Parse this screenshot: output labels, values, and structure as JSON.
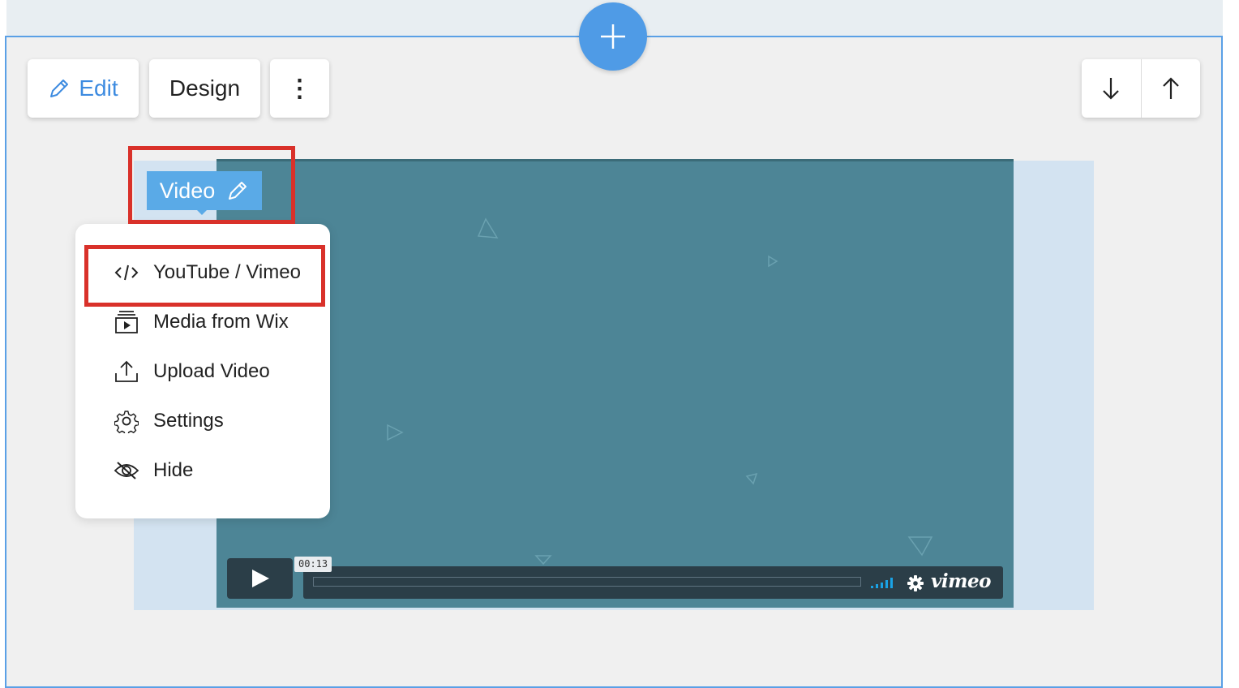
{
  "toolbar": {
    "edit_label": "Edit",
    "design_label": "Design",
    "more_label": "⋮"
  },
  "video_element": {
    "tag_label": "Video"
  },
  "menu": {
    "items": [
      {
        "label": "YouTube / Vimeo",
        "icon": "code-icon"
      },
      {
        "label": "Media from Wix",
        "icon": "media-library-icon"
      },
      {
        "label": "Upload Video",
        "icon": "upload-icon"
      },
      {
        "label": "Settings",
        "icon": "gear-icon"
      },
      {
        "label": "Hide",
        "icon": "eye-off-icon"
      }
    ]
  },
  "player": {
    "time": "00:13",
    "brand": "vimeo"
  },
  "colors": {
    "accent": "#4f9be6",
    "highlight": "#d9312a",
    "player_bg": "#4d8596"
  }
}
